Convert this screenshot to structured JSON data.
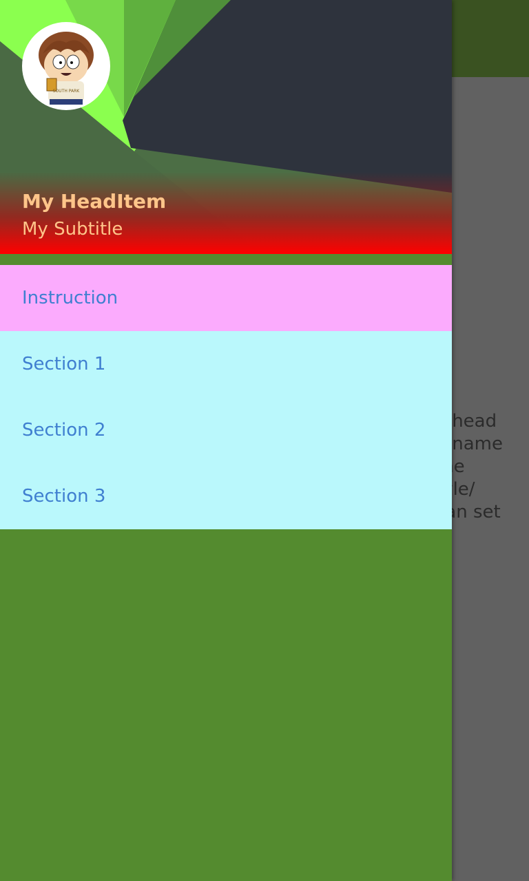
{
  "header": {
    "title": "My HeadItem",
    "subtitle": "My Subtitle",
    "avatar_label": "SOUTH PARK"
  },
  "menu": {
    "items": [
      {
        "label": "Instruction"
      },
      {
        "label": "Section 1"
      },
      {
        "label": "Section 2"
      },
      {
        "label": "Section 3"
      }
    ]
  },
  "background_text": {
    "lines": [
      "a head",
      "e name",
      "the",
      "tyle/",
      " can set"
    ]
  },
  "colors": {
    "toolbar": "#3a5221",
    "content_bg": "#616161",
    "drawer_bg": "#548b2f",
    "header_text": "#ffc58a",
    "menu_text": "#3f7fd0",
    "instruction_bg": "#fbabfd",
    "section_bg": "#baf8fc"
  }
}
